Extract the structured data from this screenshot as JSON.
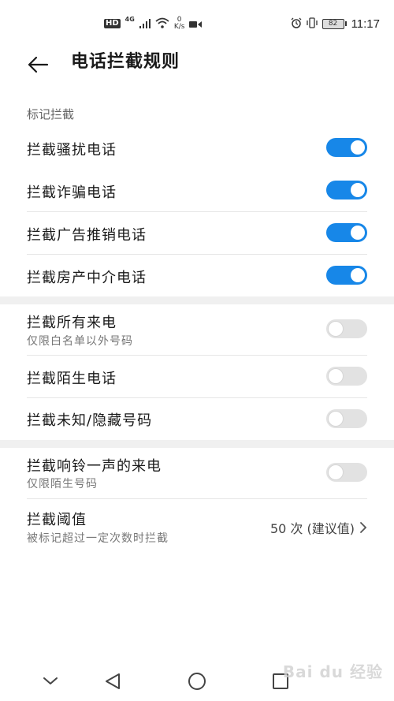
{
  "status_bar": {
    "hd_label": "HD",
    "network_label": "4G",
    "speed_value": "0",
    "speed_unit": "K/s",
    "battery_level": "82",
    "time": "11:17"
  },
  "header": {
    "title": "电话拦截规则"
  },
  "sections": {
    "marked_label": "标记拦截"
  },
  "rows": [
    {
      "title": "拦截骚扰电话",
      "enabled": true
    },
    {
      "title": "拦截诈骗电话",
      "enabled": true
    },
    {
      "title": "拦截广告推销电话",
      "enabled": true
    },
    {
      "title": "拦截房产中介电话",
      "enabled": true
    },
    {
      "title": "拦截所有来电",
      "subtitle": "仅限白名单以外号码",
      "enabled": false
    },
    {
      "title": "拦截陌生电话",
      "enabled": false
    },
    {
      "title": "拦截未知/隐藏号码",
      "enabled": false
    },
    {
      "title": "拦截响铃一声的来电",
      "subtitle": "仅限陌生号码",
      "enabled": false
    },
    {
      "title": "拦截阈值",
      "subtitle": "被标记超过一定次数时拦截",
      "value": "50 次 (建议值)"
    }
  ],
  "watermark": "Bai du 经验",
  "colors": {
    "toggle_on": "#1787e8",
    "toggle_off": "#e2e2e2"
  }
}
